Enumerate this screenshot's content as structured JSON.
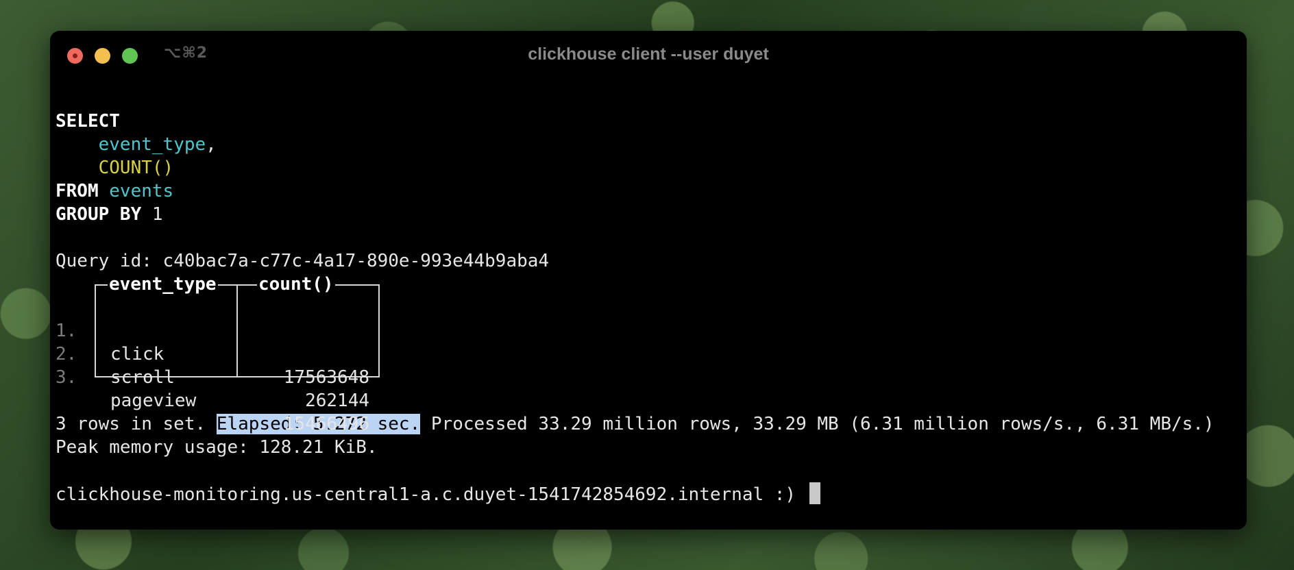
{
  "window": {
    "shortcut": "⌥⌘2",
    "title": "clickhouse client --user duyet"
  },
  "query": {
    "select_kw": "SELECT",
    "col1": "event_type",
    "col1_sep": ",",
    "col2": "COUNT()",
    "from_kw": "FROM",
    "table": "events",
    "group_kw": "GROUP BY",
    "group_val": "1",
    "query_id_label": "Query id: ",
    "query_id": "c40bac7a-c77c-4a17-890e-993e44b9aba4"
  },
  "results": {
    "headers": [
      "event_type",
      "count()"
    ],
    "rows": [
      {
        "num": "1.",
        "event_type": "click",
        "count": "17563648"
      },
      {
        "num": "2.",
        "event_type": "scroll",
        "count": "262144"
      },
      {
        "num": "3.",
        "event_type": "pageview",
        "count": "15466496"
      }
    ]
  },
  "summary": {
    "rows_text": "3 rows in set. ",
    "elapsed": "Elapsed: 5.272 sec.",
    "processed": " Processed 33.29 million rows, 33.29 MB (6.31 million rows/s., 6.31 MB/s.)",
    "memory": "Peak memory usage: 128.21 KiB."
  },
  "prompt": "clickhouse-monitoring.us-central1-a.c.duyet-1541742854692.internal :) ",
  "colors": {
    "keyword": "#ffffff",
    "identifier": "#4fc6cc",
    "function": "#d8d23f",
    "selection": "#bcd4f4"
  }
}
